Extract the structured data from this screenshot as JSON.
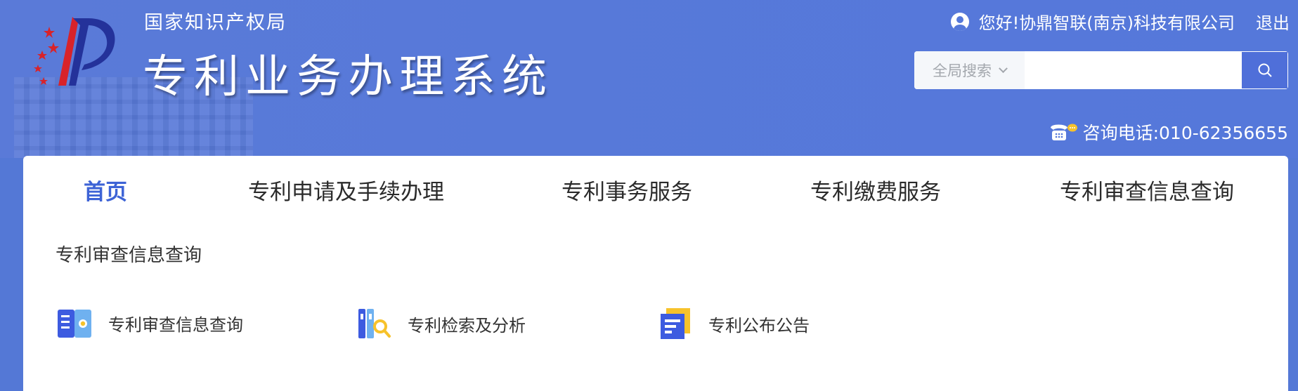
{
  "header": {
    "org_name": "国家知识产权局",
    "system_title": "专利业务办理系统",
    "greeting": "您好!协鼎智联(南京)科技有限公司",
    "logout_label": "退出",
    "search": {
      "scope_label": "全局搜索",
      "placeholder": ""
    },
    "phone_text": "咨询电话:010-62356655"
  },
  "nav": {
    "items": [
      {
        "label": "首页",
        "active": true
      },
      {
        "label": "专利申请及手续办理",
        "active": false
      },
      {
        "label": "专利事务服务",
        "active": false
      },
      {
        "label": "专利缴费服务",
        "active": false
      },
      {
        "label": "专利审查信息查询",
        "active": false
      }
    ]
  },
  "main": {
    "section_title": "专利审查信息查询",
    "services": [
      {
        "label": "专利审查信息查询",
        "icon": "book-search-icon"
      },
      {
        "label": "专利检索及分析",
        "icon": "binder-magnifier-icon"
      },
      {
        "label": "专利公布公告",
        "icon": "document-icon"
      }
    ]
  },
  "colors": {
    "header_bg": "#5578da",
    "accent": "#3d63d6",
    "search_btn": "#4f6fd9",
    "icon_blue": "#3d5be0",
    "icon_yellow": "#f7c22b",
    "icon_light_blue": "#6fb1f0"
  }
}
